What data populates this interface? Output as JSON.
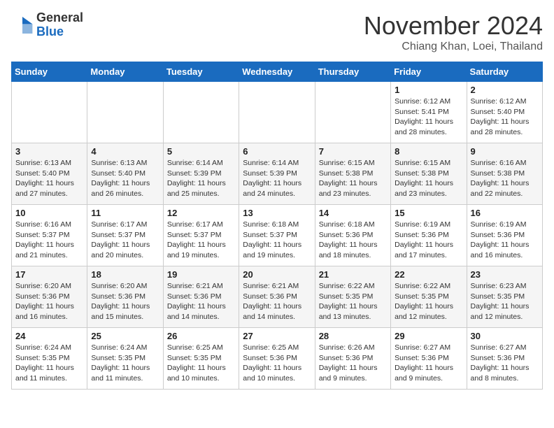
{
  "header": {
    "logo_general": "General",
    "logo_blue": "Blue",
    "month_title": "November 2024",
    "location": "Chiang Khan, Loei, Thailand"
  },
  "days_of_week": [
    "Sunday",
    "Monday",
    "Tuesday",
    "Wednesday",
    "Thursday",
    "Friday",
    "Saturday"
  ],
  "weeks": [
    [
      {
        "day": "",
        "info": ""
      },
      {
        "day": "",
        "info": ""
      },
      {
        "day": "",
        "info": ""
      },
      {
        "day": "",
        "info": ""
      },
      {
        "day": "",
        "info": ""
      },
      {
        "day": "1",
        "info": "Sunrise: 6:12 AM\nSunset: 5:41 PM\nDaylight: 11 hours and 28 minutes."
      },
      {
        "day": "2",
        "info": "Sunrise: 6:12 AM\nSunset: 5:40 PM\nDaylight: 11 hours and 28 minutes."
      }
    ],
    [
      {
        "day": "3",
        "info": "Sunrise: 6:13 AM\nSunset: 5:40 PM\nDaylight: 11 hours and 27 minutes."
      },
      {
        "day": "4",
        "info": "Sunrise: 6:13 AM\nSunset: 5:40 PM\nDaylight: 11 hours and 26 minutes."
      },
      {
        "day": "5",
        "info": "Sunrise: 6:14 AM\nSunset: 5:39 PM\nDaylight: 11 hours and 25 minutes."
      },
      {
        "day": "6",
        "info": "Sunrise: 6:14 AM\nSunset: 5:39 PM\nDaylight: 11 hours and 24 minutes."
      },
      {
        "day": "7",
        "info": "Sunrise: 6:15 AM\nSunset: 5:38 PM\nDaylight: 11 hours and 23 minutes."
      },
      {
        "day": "8",
        "info": "Sunrise: 6:15 AM\nSunset: 5:38 PM\nDaylight: 11 hours and 23 minutes."
      },
      {
        "day": "9",
        "info": "Sunrise: 6:16 AM\nSunset: 5:38 PM\nDaylight: 11 hours and 22 minutes."
      }
    ],
    [
      {
        "day": "10",
        "info": "Sunrise: 6:16 AM\nSunset: 5:37 PM\nDaylight: 11 hours and 21 minutes."
      },
      {
        "day": "11",
        "info": "Sunrise: 6:17 AM\nSunset: 5:37 PM\nDaylight: 11 hours and 20 minutes."
      },
      {
        "day": "12",
        "info": "Sunrise: 6:17 AM\nSunset: 5:37 PM\nDaylight: 11 hours and 19 minutes."
      },
      {
        "day": "13",
        "info": "Sunrise: 6:18 AM\nSunset: 5:37 PM\nDaylight: 11 hours and 19 minutes."
      },
      {
        "day": "14",
        "info": "Sunrise: 6:18 AM\nSunset: 5:36 PM\nDaylight: 11 hours and 18 minutes."
      },
      {
        "day": "15",
        "info": "Sunrise: 6:19 AM\nSunset: 5:36 PM\nDaylight: 11 hours and 17 minutes."
      },
      {
        "day": "16",
        "info": "Sunrise: 6:19 AM\nSunset: 5:36 PM\nDaylight: 11 hours and 16 minutes."
      }
    ],
    [
      {
        "day": "17",
        "info": "Sunrise: 6:20 AM\nSunset: 5:36 PM\nDaylight: 11 hours and 16 minutes."
      },
      {
        "day": "18",
        "info": "Sunrise: 6:20 AM\nSunset: 5:36 PM\nDaylight: 11 hours and 15 minutes."
      },
      {
        "day": "19",
        "info": "Sunrise: 6:21 AM\nSunset: 5:36 PM\nDaylight: 11 hours and 14 minutes."
      },
      {
        "day": "20",
        "info": "Sunrise: 6:21 AM\nSunset: 5:36 PM\nDaylight: 11 hours and 14 minutes."
      },
      {
        "day": "21",
        "info": "Sunrise: 6:22 AM\nSunset: 5:35 PM\nDaylight: 11 hours and 13 minutes."
      },
      {
        "day": "22",
        "info": "Sunrise: 6:22 AM\nSunset: 5:35 PM\nDaylight: 11 hours and 12 minutes."
      },
      {
        "day": "23",
        "info": "Sunrise: 6:23 AM\nSunset: 5:35 PM\nDaylight: 11 hours and 12 minutes."
      }
    ],
    [
      {
        "day": "24",
        "info": "Sunrise: 6:24 AM\nSunset: 5:35 PM\nDaylight: 11 hours and 11 minutes."
      },
      {
        "day": "25",
        "info": "Sunrise: 6:24 AM\nSunset: 5:35 PM\nDaylight: 11 hours and 11 minutes."
      },
      {
        "day": "26",
        "info": "Sunrise: 6:25 AM\nSunset: 5:35 PM\nDaylight: 11 hours and 10 minutes."
      },
      {
        "day": "27",
        "info": "Sunrise: 6:25 AM\nSunset: 5:36 PM\nDaylight: 11 hours and 10 minutes."
      },
      {
        "day": "28",
        "info": "Sunrise: 6:26 AM\nSunset: 5:36 PM\nDaylight: 11 hours and 9 minutes."
      },
      {
        "day": "29",
        "info": "Sunrise: 6:27 AM\nSunset: 5:36 PM\nDaylight: 11 hours and 9 minutes."
      },
      {
        "day": "30",
        "info": "Sunrise: 6:27 AM\nSunset: 5:36 PM\nDaylight: 11 hours and 8 minutes."
      }
    ]
  ]
}
